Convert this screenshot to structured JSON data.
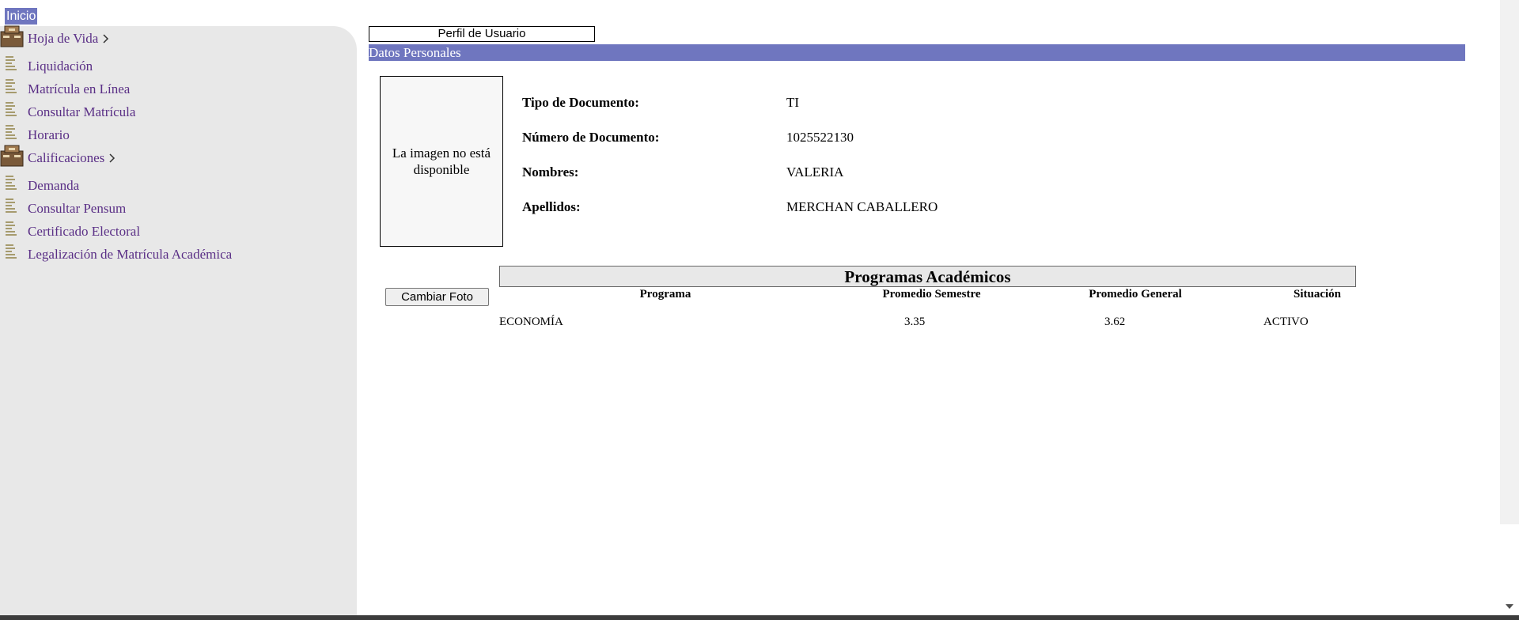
{
  "topbar": {
    "inicio": "Inicio"
  },
  "sidebar": {
    "items": [
      {
        "label": "Hoja de Vida",
        "type": "folder"
      },
      {
        "label": "Liquidación",
        "type": "doc"
      },
      {
        "label": "Matrícula en Línea",
        "type": "doc"
      },
      {
        "label": "Consultar Matrícula",
        "type": "doc"
      },
      {
        "label": "Horario",
        "type": "doc"
      },
      {
        "label": "Calificaciones",
        "type": "folder"
      },
      {
        "label": "Demanda",
        "type": "doc"
      },
      {
        "label": "Consultar Pensum",
        "type": "doc"
      },
      {
        "label": "Certificado Electoral",
        "type": "doc"
      },
      {
        "label": "Legalización de Matrícula Académica",
        "type": "doc"
      }
    ],
    "icons": {
      "folder": "box-folder-icon",
      "doc": "document-lines-icon",
      "expand": "chevron-right-icon"
    }
  },
  "profile": {
    "header": "Perfil de Usuario",
    "section": "Datos Personales",
    "photo_placeholder": "La imagen no está disponible",
    "change_photo": "Cambiar Foto",
    "fields": [
      {
        "label": "Tipo de Documento:",
        "value": "TI"
      },
      {
        "label": "Número de Documento:",
        "value": "1025522130"
      },
      {
        "label": "Nombres:",
        "value": "VALERIA"
      },
      {
        "label": "Apellidos:",
        "value": "MERCHAN CABALLERO"
      }
    ]
  },
  "programs": {
    "title": "Programas Académicos",
    "columns": [
      "Programa",
      "Promedio Semestre",
      "Promedio General",
      "Situación"
    ],
    "rows": [
      [
        "ECONOMÍA",
        "3.35",
        "3.62",
        "ACTIVO"
      ]
    ]
  },
  "colors": {
    "accent": "#6f76bf",
    "link": "#5a2f86",
    "sidebar_bg": "#e8e8e8"
  }
}
